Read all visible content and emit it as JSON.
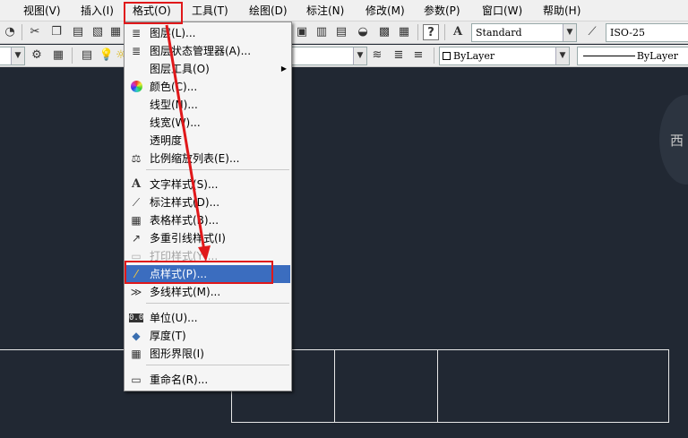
{
  "menubar": {
    "items": [
      "视图(V)",
      "插入(I)",
      "格式(O)",
      "工具(T)",
      "绘图(D)",
      "标注(N)",
      "修改(M)",
      "参数(P)",
      "窗口(W)",
      "帮助(H)"
    ]
  },
  "toolbar": {
    "text_style": "Standard",
    "dim_style": "ISO-25",
    "color_combo": "ByLayer",
    "linetype_combo": "ByLayer"
  },
  "format_menu": {
    "items": [
      {
        "label": "图层(L)...",
        "icon": "layer-icon"
      },
      {
        "label": "图层状态管理器(A)...",
        "icon": "layer-state-icon"
      },
      {
        "label": "图层工具(O)",
        "icon": "",
        "submenu": true
      },
      {
        "label": "颜色(C)...",
        "icon": "color-wheel-icon"
      },
      {
        "label": "线型(N)...",
        "icon": ""
      },
      {
        "label": "线宽(W)...",
        "icon": ""
      },
      {
        "label": "透明度",
        "icon": ""
      },
      {
        "label": "比例缩放列表(E)...",
        "icon": "scale-list-icon"
      },
      {
        "label": "文字样式(S)...",
        "icon": "text-style-icon"
      },
      {
        "label": "标注样式(D)...",
        "icon": "dim-style-icon"
      },
      {
        "label": "表格样式(B)...",
        "icon": "table-style-icon"
      },
      {
        "label": "多重引线样式(I)",
        "icon": "mleader-style-icon"
      },
      {
        "label": "打印样式(Y)...",
        "icon": "plot-style-icon",
        "disabled": true
      },
      {
        "label": "点样式(P)...",
        "icon": "point-style-icon",
        "selected": true
      },
      {
        "label": "多线样式(M)...",
        "icon": "mline-style-icon"
      },
      {
        "label": "单位(U)...",
        "icon": "units-icon"
      },
      {
        "label": "厚度(T)",
        "icon": "thickness-icon"
      },
      {
        "label": "图形界限(I)",
        "icon": "limits-icon"
      },
      {
        "label": "重命名(R)...",
        "icon": "rename-icon"
      }
    ]
  },
  "viewcube": {
    "label": "西"
  },
  "colors": {
    "canvas": "#212833",
    "selection": "#3b6dbf",
    "highlight": "#e0181a",
    "arrow": "#e0181a"
  }
}
